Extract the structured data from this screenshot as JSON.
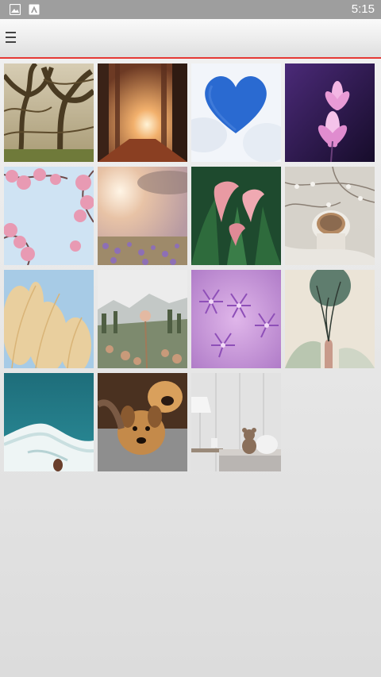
{
  "status_bar": {
    "time": "5:15",
    "icons": [
      "image-notification-icon",
      "store-notification-icon"
    ]
  },
  "app_bar": {
    "menu_icon": "hamburger-menu-icon",
    "accent_color": "#e53935"
  },
  "gallery": {
    "items": [
      {
        "name": "twisted-trees",
        "palette": [
          "#7a6a4e",
          "#5d4b2c"
        ]
      },
      {
        "name": "forest-sunlight",
        "palette": [
          "#b56a45",
          "#f3d2a3"
        ]
      },
      {
        "name": "heart-sky",
        "palette": [
          "#2f6ed6",
          "#eef3fb"
        ]
      },
      {
        "name": "pink-lotus",
        "palette": [
          "#2c1a4a",
          "#e9a1d8"
        ]
      },
      {
        "name": "cherry-blossom",
        "palette": [
          "#cfe3f3",
          "#e59bb4"
        ]
      },
      {
        "name": "meadow-sunset",
        "palette": [
          "#d9b49a",
          "#8d6fb5"
        ]
      },
      {
        "name": "calla-lilies",
        "palette": [
          "#1c3b25",
          "#e89aa2"
        ]
      },
      {
        "name": "coffee-blossom",
        "palette": [
          "#d9d5cd",
          "#8b6a4f"
        ]
      },
      {
        "name": "golden-grass",
        "palette": [
          "#9ec3e3",
          "#e9cf9e"
        ]
      },
      {
        "name": "wildflower-field",
        "palette": [
          "#d9d9d9",
          "#c89a7a"
        ]
      },
      {
        "name": "purple-allium",
        "palette": [
          "#c792d8",
          "#9a5bc2"
        ]
      },
      {
        "name": "boho-vase",
        "palette": [
          "#e9e1d3",
          "#5f7d6e"
        ]
      },
      {
        "name": "ocean-waves",
        "palette": [
          "#1f6f7a",
          "#eef5f5"
        ]
      },
      {
        "name": "puppies",
        "palette": [
          "#5b3c23",
          "#c48a4a"
        ]
      },
      {
        "name": "bedroom-teddy",
        "palette": [
          "#dedede",
          "#8a6f5a"
        ]
      }
    ]
  }
}
